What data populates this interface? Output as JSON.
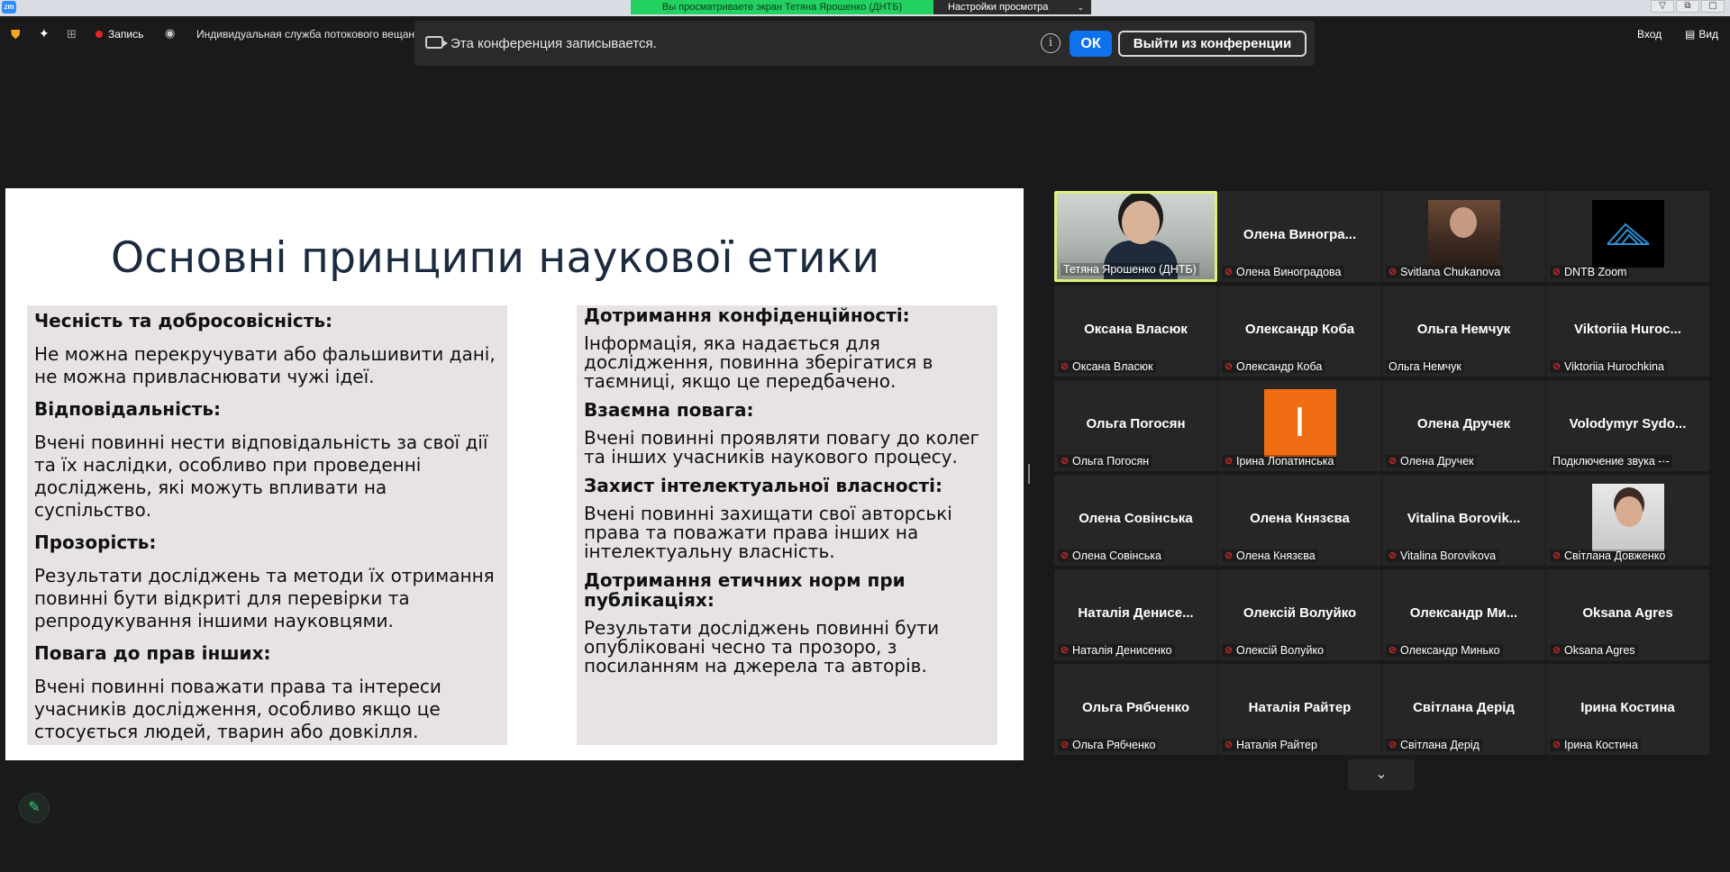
{
  "topbar": {
    "logo": "zm",
    "share_banner": "Вы просматриваете экран Тетяна Ярошенко (ДНТБ)",
    "view_settings": "Настройки просмотра",
    "window_controls": [
      "▽",
      "⧉",
      "▢"
    ]
  },
  "toolbar": {
    "record_label": "Запись",
    "service_label": "Индивидуальная служба потокового вещан",
    "login_label": "Вход",
    "view_label": "Вид",
    "recording_color": "#e02828"
  },
  "recording_notice": {
    "message": "Эта конференция записывается.",
    "ok_label": "ОК",
    "leave_label": "Выйти из конференции",
    "accent": "#0e72ed"
  },
  "slide": {
    "title": "Основні принципи наукової етики",
    "left": [
      {
        "heading": "Чесність та добросовісність:",
        "text": "Не можна перекручувати або фальшивити дані, не можна привласнювати чужі ідеї."
      },
      {
        "heading": "Відповідальність:",
        "text": "Вчені повинні нести відповідальність за свої дії та їх наслідки, особливо при проведенні досліджень, які можуть впливати на суспільство."
      },
      {
        "heading": "Прозорість:",
        "text": "Результати досліджень та методи їх отримання повинні бути відкриті для перевірки та репродукування іншими науковцями."
      },
      {
        "heading": "Повага до прав інших:",
        "text": "Вчені повинні поважати права та інтереси учасників дослідження, особливо якщо це стосується людей, тварин або довкілля."
      }
    ],
    "right": [
      {
        "heading": "Дотримання конфіденційності:",
        "text": "Інформація, яка надається для дослідження, повинна зберігатися в таємниці, якщо це передбачено."
      },
      {
        "heading": "Взаємна повага:",
        "text": "Вчені повинні проявляти повагу до колег та інших учасників наукового процесу."
      },
      {
        "heading": "Захист інтелектуальної власності:",
        "text": "Вчені повинні захищати свої авторські права та поважати права інших на інтелектуальну власність."
      },
      {
        "heading": "Дотримання етичних норм при публікаціях:",
        "text": "Результати досліджень повинні бути опубліковані чесно та прозоро, з посиланням на джерела та авторів."
      }
    ]
  },
  "gallery": {
    "tiles": [
      {
        "big": "",
        "label": "Тетяна Ярошенко (ДНТБ)",
        "muted": false,
        "media": "camera",
        "active": true
      },
      {
        "big": "Олена  Виногра...",
        "label": "Олена Виноградова",
        "muted": true,
        "media": "none"
      },
      {
        "big": "",
        "label": "Svitlana Chukanova",
        "muted": true,
        "media": "photo-brown"
      },
      {
        "big": "",
        "label": "DNTB Zoom",
        "muted": true,
        "media": "dntb-logo"
      },
      {
        "big": "Оксана Власюк",
        "label": "Оксана Власюк",
        "muted": true,
        "media": "none"
      },
      {
        "big": "Олександр Коба",
        "label": "Олександр Коба",
        "muted": true,
        "media": "none"
      },
      {
        "big": "Ольга Немчук",
        "label": "Ольга Немчук",
        "muted": false,
        "media": "none"
      },
      {
        "big": "Viktoriia  Huroc...",
        "label": "Viktoriia Hurochkina",
        "muted": true,
        "media": "none"
      },
      {
        "big": "Ольга Погосян",
        "label": "Ольга Погосян",
        "muted": true,
        "media": "none"
      },
      {
        "big": "",
        "label": "Ірина Лопатинська",
        "muted": true,
        "media": "avatar-orange",
        "avatar_letter": "І"
      },
      {
        "big": "Олена Дручек",
        "label": "Олена Дручек",
        "muted": true,
        "media": "none"
      },
      {
        "big": "Volodymyr  Sydo...",
        "label": "Подключение звука -·-",
        "muted": false,
        "media": "none"
      },
      {
        "big": "Олена Совінська",
        "label": "Олена Совінська",
        "muted": true,
        "media": "none"
      },
      {
        "big": "Олена Князєва",
        "label": "Олена Князєва",
        "muted": true,
        "media": "none"
      },
      {
        "big": "Vitalina  Borovik...",
        "label": "Vitalina Borovikova",
        "muted": true,
        "media": "none"
      },
      {
        "big": "",
        "label": "Світлана Довженко",
        "muted": true,
        "media": "photo-light"
      },
      {
        "big": "Наталія  Денисе...",
        "label": "Наталія Денисенко",
        "muted": true,
        "media": "none"
      },
      {
        "big": "Олексій Волуйко",
        "label": "Олексій Волуйко",
        "muted": true,
        "media": "none"
      },
      {
        "big": "Олександр  Ми...",
        "label": "Олександр Минько",
        "muted": true,
        "media": "none"
      },
      {
        "big": "Oksana Agres",
        "label": "Oksana Agres",
        "muted": true,
        "media": "none"
      },
      {
        "big": "Ольга Рябченко",
        "label": "Ольга Рябченко",
        "muted": true,
        "media": "none"
      },
      {
        "big": "Наталія Райтер",
        "label": "Наталія Райтер",
        "muted": true,
        "media": "none"
      },
      {
        "big": "Світлана Дерід",
        "label": "Світлана Дерід",
        "muted": true,
        "media": "none"
      },
      {
        "big": "Ірина Костина",
        "label": "Ірина Костина",
        "muted": true,
        "media": "none"
      }
    ]
  }
}
